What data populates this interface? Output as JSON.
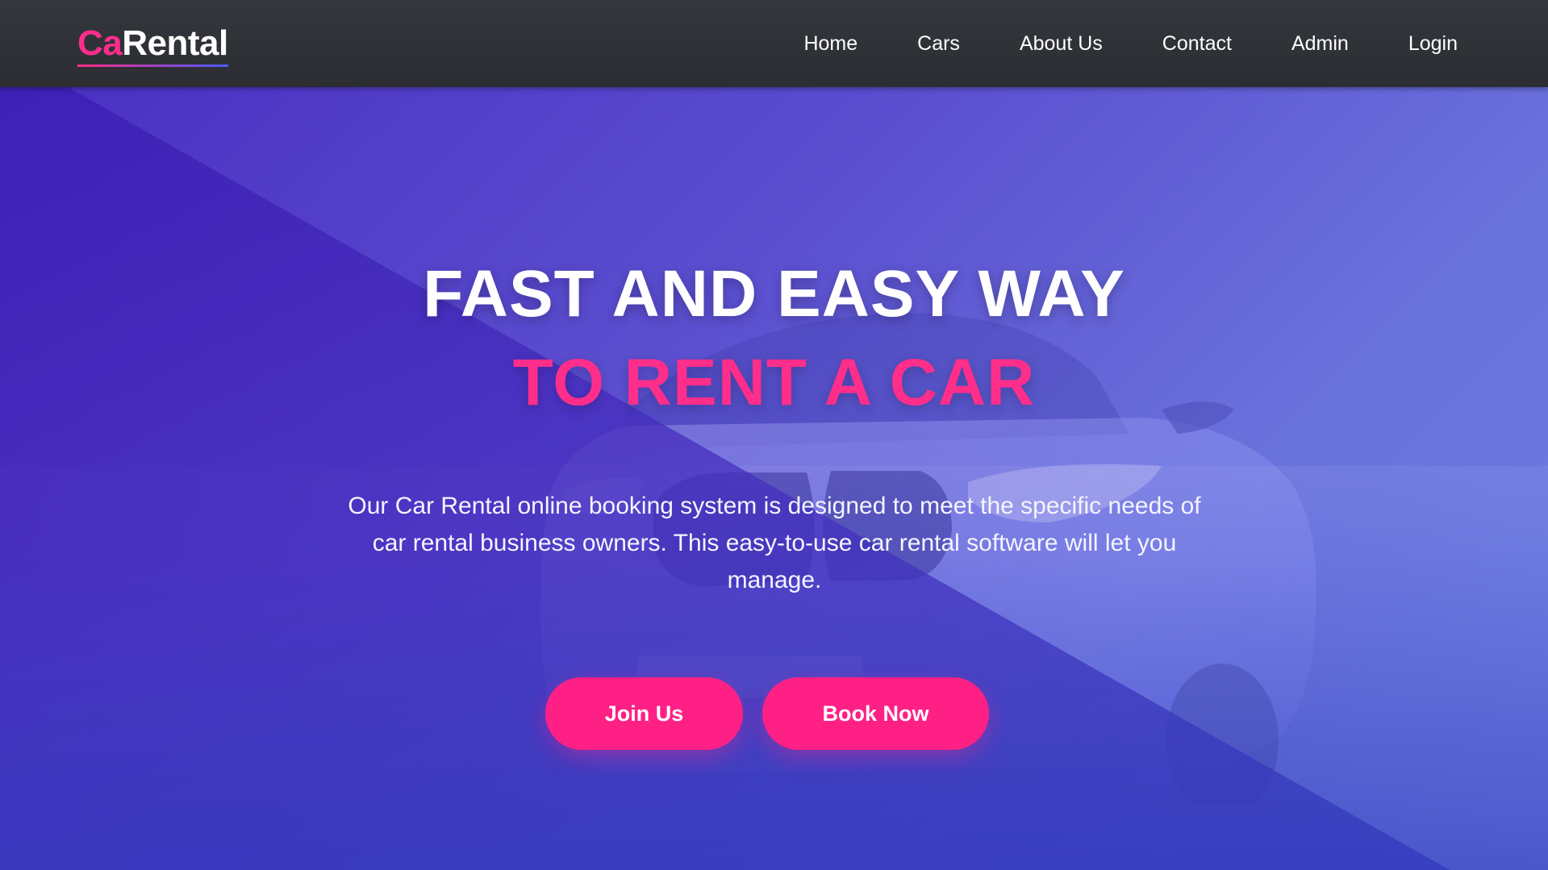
{
  "brand": {
    "accent_part": "Ca",
    "rest": "Rental",
    "accent_color": "#ff2e8a"
  },
  "nav": {
    "items": [
      "Home",
      "Cars",
      "About Us",
      "Contact",
      "Admin",
      "Login"
    ]
  },
  "hero": {
    "title_line1": "FAST AND EASY WAY",
    "title_line2": "TO RENT A CAR",
    "description": "Our Car Rental online booking system is designed to meet the specific needs of car rental business owners. This easy-to-use car rental software will let you manage.",
    "primary_color": "#ff2086",
    "background_color": "#5b4fd0",
    "buttons": {
      "join": "Join Us",
      "book": "Book Now"
    }
  }
}
